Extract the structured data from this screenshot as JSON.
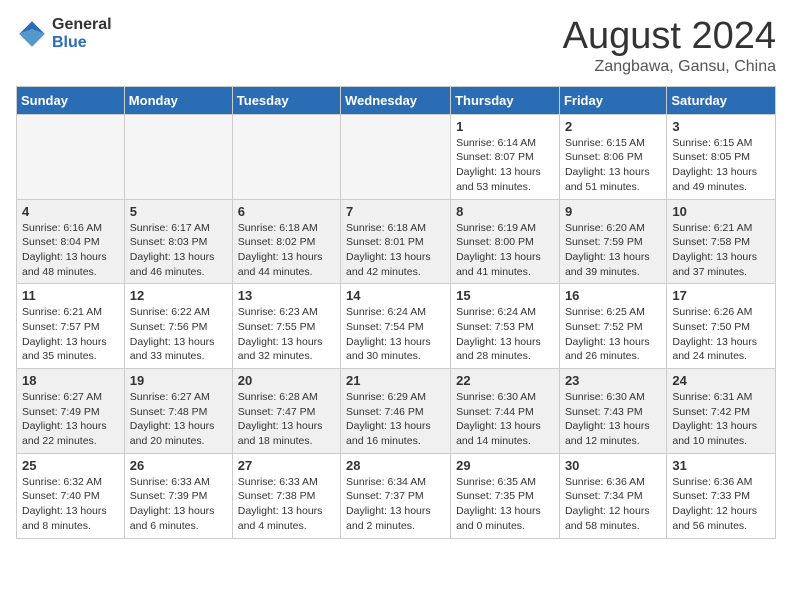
{
  "logo": {
    "general": "General",
    "blue": "Blue"
  },
  "header": {
    "month_year": "August 2024",
    "location": "Zangbawa, Gansu, China"
  },
  "weekdays": [
    "Sunday",
    "Monday",
    "Tuesday",
    "Wednesday",
    "Thursday",
    "Friday",
    "Saturday"
  ],
  "weeks": [
    [
      {
        "day": "",
        "info": ""
      },
      {
        "day": "",
        "info": ""
      },
      {
        "day": "",
        "info": ""
      },
      {
        "day": "",
        "info": ""
      },
      {
        "day": "1",
        "info": "Sunrise: 6:14 AM\nSunset: 8:07 PM\nDaylight: 13 hours\nand 53 minutes."
      },
      {
        "day": "2",
        "info": "Sunrise: 6:15 AM\nSunset: 8:06 PM\nDaylight: 13 hours\nand 51 minutes."
      },
      {
        "day": "3",
        "info": "Sunrise: 6:15 AM\nSunset: 8:05 PM\nDaylight: 13 hours\nand 49 minutes."
      }
    ],
    [
      {
        "day": "4",
        "info": "Sunrise: 6:16 AM\nSunset: 8:04 PM\nDaylight: 13 hours\nand 48 minutes."
      },
      {
        "day": "5",
        "info": "Sunrise: 6:17 AM\nSunset: 8:03 PM\nDaylight: 13 hours\nand 46 minutes."
      },
      {
        "day": "6",
        "info": "Sunrise: 6:18 AM\nSunset: 8:02 PM\nDaylight: 13 hours\nand 44 minutes."
      },
      {
        "day": "7",
        "info": "Sunrise: 6:18 AM\nSunset: 8:01 PM\nDaylight: 13 hours\nand 42 minutes."
      },
      {
        "day": "8",
        "info": "Sunrise: 6:19 AM\nSunset: 8:00 PM\nDaylight: 13 hours\nand 41 minutes."
      },
      {
        "day": "9",
        "info": "Sunrise: 6:20 AM\nSunset: 7:59 PM\nDaylight: 13 hours\nand 39 minutes."
      },
      {
        "day": "10",
        "info": "Sunrise: 6:21 AM\nSunset: 7:58 PM\nDaylight: 13 hours\nand 37 minutes."
      }
    ],
    [
      {
        "day": "11",
        "info": "Sunrise: 6:21 AM\nSunset: 7:57 PM\nDaylight: 13 hours\nand 35 minutes."
      },
      {
        "day": "12",
        "info": "Sunrise: 6:22 AM\nSunset: 7:56 PM\nDaylight: 13 hours\nand 33 minutes."
      },
      {
        "day": "13",
        "info": "Sunrise: 6:23 AM\nSunset: 7:55 PM\nDaylight: 13 hours\nand 32 minutes."
      },
      {
        "day": "14",
        "info": "Sunrise: 6:24 AM\nSunset: 7:54 PM\nDaylight: 13 hours\nand 30 minutes."
      },
      {
        "day": "15",
        "info": "Sunrise: 6:24 AM\nSunset: 7:53 PM\nDaylight: 13 hours\nand 28 minutes."
      },
      {
        "day": "16",
        "info": "Sunrise: 6:25 AM\nSunset: 7:52 PM\nDaylight: 13 hours\nand 26 minutes."
      },
      {
        "day": "17",
        "info": "Sunrise: 6:26 AM\nSunset: 7:50 PM\nDaylight: 13 hours\nand 24 minutes."
      }
    ],
    [
      {
        "day": "18",
        "info": "Sunrise: 6:27 AM\nSunset: 7:49 PM\nDaylight: 13 hours\nand 22 minutes."
      },
      {
        "day": "19",
        "info": "Sunrise: 6:27 AM\nSunset: 7:48 PM\nDaylight: 13 hours\nand 20 minutes."
      },
      {
        "day": "20",
        "info": "Sunrise: 6:28 AM\nSunset: 7:47 PM\nDaylight: 13 hours\nand 18 minutes."
      },
      {
        "day": "21",
        "info": "Sunrise: 6:29 AM\nSunset: 7:46 PM\nDaylight: 13 hours\nand 16 minutes."
      },
      {
        "day": "22",
        "info": "Sunrise: 6:30 AM\nSunset: 7:44 PM\nDaylight: 13 hours\nand 14 minutes."
      },
      {
        "day": "23",
        "info": "Sunrise: 6:30 AM\nSunset: 7:43 PM\nDaylight: 13 hours\nand 12 minutes."
      },
      {
        "day": "24",
        "info": "Sunrise: 6:31 AM\nSunset: 7:42 PM\nDaylight: 13 hours\nand 10 minutes."
      }
    ],
    [
      {
        "day": "25",
        "info": "Sunrise: 6:32 AM\nSunset: 7:40 PM\nDaylight: 13 hours\nand 8 minutes."
      },
      {
        "day": "26",
        "info": "Sunrise: 6:33 AM\nSunset: 7:39 PM\nDaylight: 13 hours\nand 6 minutes."
      },
      {
        "day": "27",
        "info": "Sunrise: 6:33 AM\nSunset: 7:38 PM\nDaylight: 13 hours\nand 4 minutes."
      },
      {
        "day": "28",
        "info": "Sunrise: 6:34 AM\nSunset: 7:37 PM\nDaylight: 13 hours\nand 2 minutes."
      },
      {
        "day": "29",
        "info": "Sunrise: 6:35 AM\nSunset: 7:35 PM\nDaylight: 13 hours\nand 0 minutes."
      },
      {
        "day": "30",
        "info": "Sunrise: 6:36 AM\nSunset: 7:34 PM\nDaylight: 12 hours\nand 58 minutes."
      },
      {
        "day": "31",
        "info": "Sunrise: 6:36 AM\nSunset: 7:33 PM\nDaylight: 12 hours\nand 56 minutes."
      }
    ]
  ]
}
